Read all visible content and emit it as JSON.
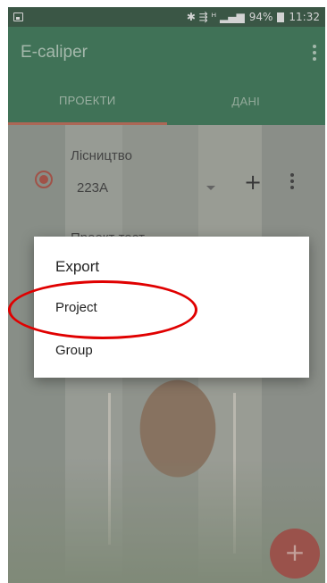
{
  "status_bar": {
    "indicators": "✱ ⇶ ᴴ ▂▄▆",
    "battery": "94%",
    "time": "11:32",
    "icons": [
      "image-icon",
      "bluetooth-icon",
      "mute-icon",
      "signal-icon",
      "battery-icon"
    ]
  },
  "app_bar": {
    "title": "E-caliper",
    "menu_icon": "more-vert-icon"
  },
  "tabs": [
    {
      "label": "ПРОЕКТИ",
      "active": true
    },
    {
      "label": "ДАНІ",
      "active": false
    }
  ],
  "project_row": {
    "label": "Лісництво",
    "value": "223А",
    "add_label": "+",
    "icons": [
      "radio-selected-icon",
      "dropdown-arrow-icon",
      "plus-icon",
      "more-vert-icon"
    ]
  },
  "second_row": {
    "label": "Проект тест"
  },
  "fab": {
    "label": "+"
  },
  "dialog": {
    "title": "Export",
    "options": [
      "Project",
      "Group"
    ]
  },
  "colors": {
    "app_bar": "#1e6b41",
    "status_bar": "#153f26",
    "tab_indicator": "#c45a3f",
    "accent": "#b13a2a",
    "fab": "#a8392e",
    "annotation": "#e00000"
  }
}
